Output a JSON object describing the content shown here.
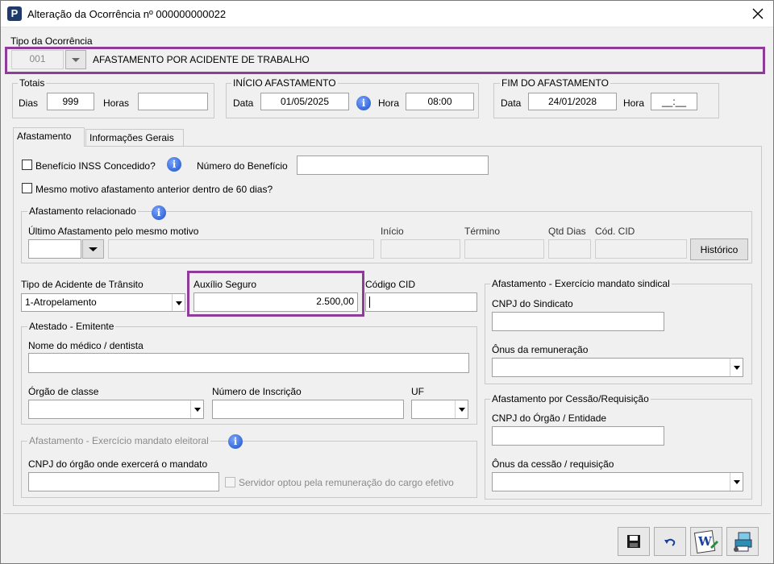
{
  "window": {
    "title": "Alteração da Ocorrência nº 000000000022",
    "app_icon": "P"
  },
  "tipo": {
    "label": "Tipo da Ocorrência",
    "code": "001",
    "description": "AFASTAMENTO POR ACIDENTE DE TRABALHO"
  },
  "totais": {
    "legend": "Totais",
    "dias_label": "Dias",
    "dias_value": "999",
    "horas_label": "Horas",
    "horas_value": ""
  },
  "inicio": {
    "legend": "INÍCIO AFASTAMENTO",
    "data_label": "Data",
    "data_value": "01/05/2025",
    "hora_label": "Hora",
    "hora_value": "08:00"
  },
  "fim": {
    "legend": "FIM DO AFASTAMENTO",
    "data_label": "Data",
    "data_value": "24/01/2028",
    "hora_label": "Hora",
    "hora_value": "__:__"
  },
  "tabs": [
    {
      "label": "Afastamento"
    },
    {
      "label": "Informações Gerais"
    }
  ],
  "beneficio": {
    "inss_label": "Benefício INSS Concedido?",
    "numero_label": "Número do Benefício",
    "numero_value": "",
    "mesmo_motivo_label": "Mesmo motivo afastamento anterior dentro de 60 dias?"
  },
  "relacionado": {
    "legend": "Afastamento relacionado",
    "ultimo_label": "Último Afastamento pelo mesmo motivo",
    "inicio_label": "Início",
    "termino_label": "Término",
    "qtd_dias_label": "Qtd Dias",
    "cod_cid_label": "Cód. CID",
    "historico_button": "Histórico"
  },
  "acidente": {
    "transito_label": "Tipo de Acidente de Trânsito",
    "transito_value": "1-Atropelamento",
    "auxilio_label": "Auxílio Seguro",
    "auxilio_value": "2.500,00",
    "cid_label": "Código CID",
    "cid_value": ""
  },
  "atestado": {
    "legend": "Atestado - Emitente",
    "nome_label": "Nome do médico / dentista",
    "orgao_label": "Órgão de classe",
    "inscricao_label": "Número de Inscrição",
    "uf_label": "UF"
  },
  "eleitoral": {
    "legend": "Afastamento - Exercício mandato eleitoral",
    "cnpj_label": "CNPJ do órgão onde exercerá o mandato",
    "servidor_label": "Servidor optou pela remuneração do cargo efetivo"
  },
  "sindical": {
    "legend": "Afastamento - Exercício mandato sindical",
    "cnpj_label": "CNPJ do Sindicato",
    "onus_label": "Ônus da remuneração"
  },
  "cessao": {
    "legend": "Afastamento por Cessão/Requisição",
    "cnpj_label": "CNPJ do Órgão / Entidade",
    "onus_label": "Ônus da cessão / requisição"
  },
  "colors": {
    "highlight": "#8e3b9a",
    "info_blue": "#1b4fc4"
  },
  "footer": {
    "icons": [
      "save-icon",
      "undo-icon",
      "word-document-icon",
      "print-setup-icon"
    ]
  }
}
